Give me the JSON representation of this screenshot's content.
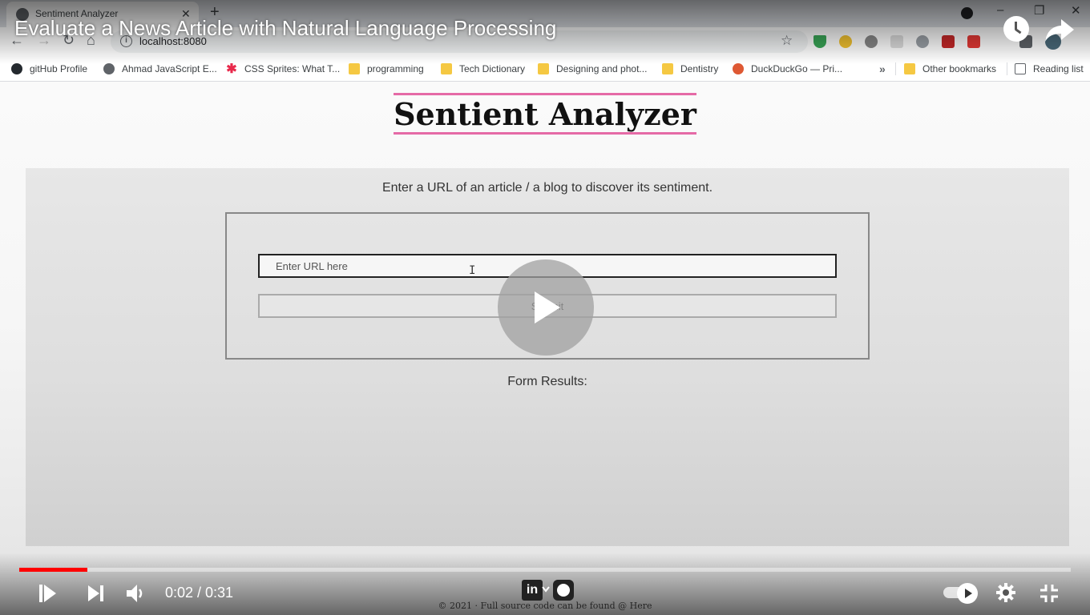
{
  "browser": {
    "tab_title": "Sentiment Analyzer",
    "url": "localhost:8080",
    "bookmarks": [
      {
        "label": "gitHub Profile",
        "icon": "github-icon"
      },
      {
        "label": "Ahmad JavaScript E...",
        "icon": "globe-icon"
      },
      {
        "label": "CSS Sprites: What T...",
        "icon": "asterisk-icon"
      },
      {
        "label": "programming",
        "icon": "folder-icon"
      },
      {
        "label": "Tech Dictionary",
        "icon": "folder-icon"
      },
      {
        "label": "Designing and phot...",
        "icon": "folder-icon"
      },
      {
        "label": "Dentistry",
        "icon": "folder-icon"
      },
      {
        "label": "DuckDuckGo — Pri...",
        "icon": "duckduckgo-icon"
      }
    ],
    "other_bookmarks": "Other bookmarks",
    "reading_list": "Reading list"
  },
  "page": {
    "title": "Sentient Analyzer",
    "instruction": "Enter a URL of an article / a blog to discover its sentiment.",
    "url_placeholder": "Enter URL here",
    "submit_label": "Submit",
    "results_label": "Form Results:",
    "footer": "© 2021 · Full source code can be found @ Here"
  },
  "player": {
    "video_title": "Evaluate a News Article with Natural Language Processing",
    "time_current": "0:02",
    "time_total": "0:31",
    "time_display": "0:02 / 0:31",
    "progress_fraction": 0.065,
    "progress_color": "#ff0000"
  },
  "colors": {
    "title_underline": "#e56aa6",
    "chrome_bg": "#dee1e6"
  }
}
